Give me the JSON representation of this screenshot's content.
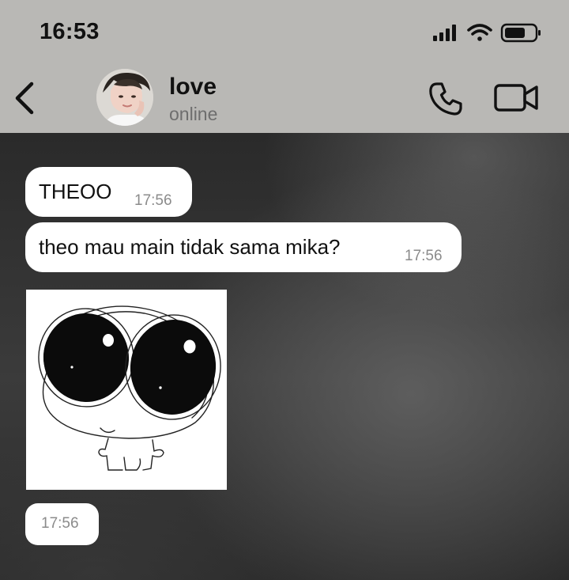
{
  "status_bar": {
    "time": "16:53"
  },
  "header": {
    "back_icon": "chevron-left-icon",
    "contact_name": "love",
    "contact_status": "online",
    "call_icon": "phone-icon",
    "video_icon": "video-camera-icon"
  },
  "messages": [
    {
      "type": "text",
      "text": "THEOO",
      "time": "17:56"
    },
    {
      "type": "text",
      "text": "theo mau main tidak sama mika?",
      "time": "17:56"
    },
    {
      "type": "sticker",
      "sticker_icon": "big-eyed-creature-sticker",
      "time": "17:56"
    }
  ],
  "colors": {
    "header_bg": "#b9b8b5",
    "bubble_bg": "#ffffff",
    "timestamp": "#8b8b8b",
    "status_text": "#6e6e6e"
  }
}
